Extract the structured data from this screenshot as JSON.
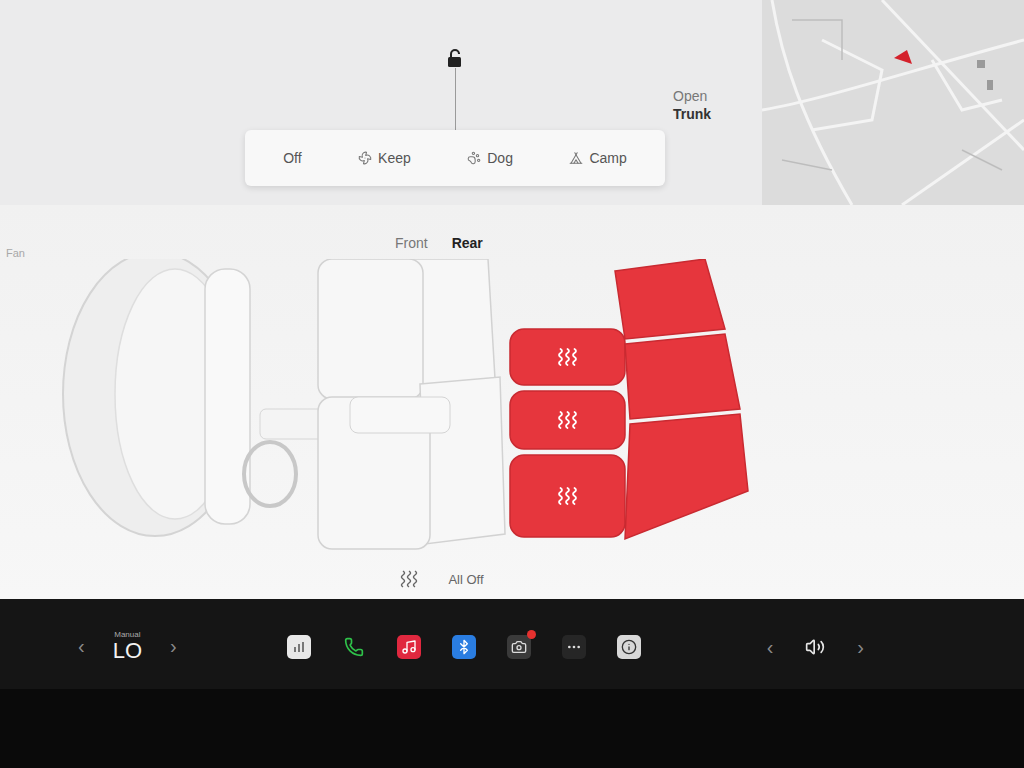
{
  "security": {
    "locked": false
  },
  "trunk": {
    "line1": "Open",
    "line2": "Trunk"
  },
  "climate_modes": [
    {
      "label": "Off",
      "kind": "off",
      "selected": false
    },
    {
      "label": "Keep",
      "kind": "keep",
      "selected": false
    },
    {
      "label": "Dog",
      "kind": "dog",
      "selected": false
    },
    {
      "label": "Camp",
      "kind": "camp",
      "selected": false
    }
  ],
  "seat_heater": {
    "fan_label": "Fan",
    "views": [
      {
        "label": "Front",
        "selected": false
      },
      {
        "label": "Rear",
        "selected": true
      }
    ],
    "seats": [
      {
        "kind": "front",
        "heated": false,
        "heat_level": 0
      },
      {
        "kind": "front",
        "heated": false,
        "heat_level": 0
      },
      {
        "kind": "rear",
        "heated": true,
        "heat_level": 3
      },
      {
        "kind": "rear",
        "heated": true,
        "heat_level": 3
      },
      {
        "kind": "rear",
        "heated": true,
        "heat_level": 3
      }
    ],
    "all_off": "All Off"
  },
  "taskbar": {
    "climate": {
      "mode": "Manual",
      "temperature": "LO",
      "prev": "‹",
      "next": "›"
    },
    "apps": [
      {
        "kind": "toybox",
        "alert": false
      },
      {
        "kind": "phone",
        "alert": false
      },
      {
        "kind": "music",
        "alert": false
      },
      {
        "kind": "bluetooth",
        "alert": false
      },
      {
        "kind": "camera",
        "alert": true
      },
      {
        "kind": "more",
        "alert": false
      },
      {
        "kind": "manual",
        "alert": false
      }
    ],
    "volume": {
      "prev": "‹",
      "next": "›"
    }
  }
}
